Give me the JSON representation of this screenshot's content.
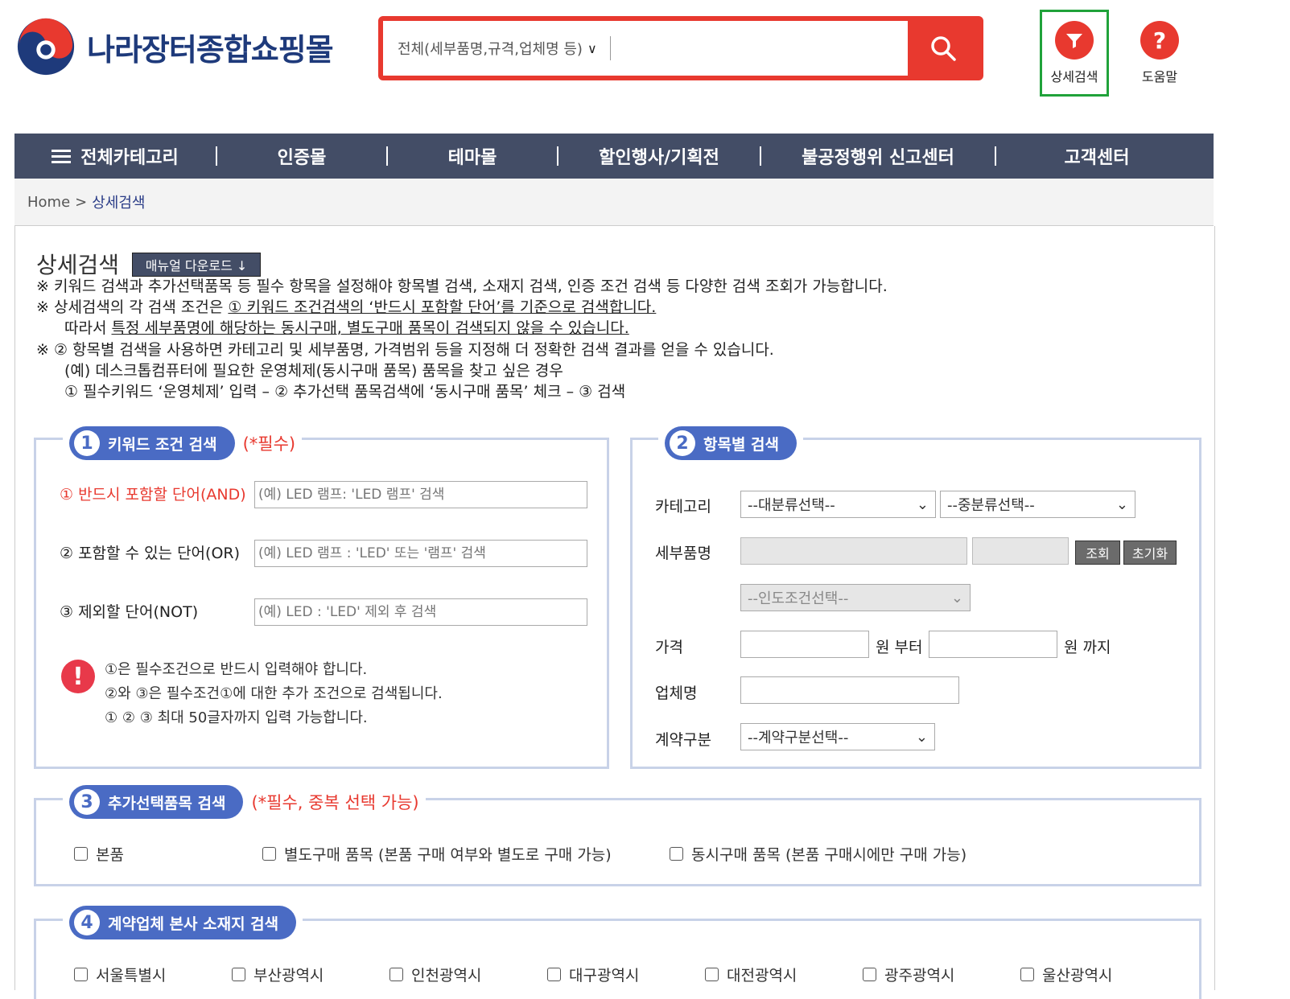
{
  "header": {
    "logo_text": "나라장터종합쇼핑몰",
    "search_scope": "전체(세부품명,규격,업체명 등)",
    "search_value": "",
    "advanced_search_label": "상세검색",
    "help_label": "도움말",
    "colors": {
      "brand_red": "#e8392f",
      "brand_navy": "#1e3a7b",
      "highlight_green": "#20a23a"
    }
  },
  "nav": {
    "items": [
      "전체카테고리",
      "인증몰",
      "테마몰",
      "할인행사/기획전",
      "불공정행위 신고센터",
      "고객센터"
    ]
  },
  "breadcrumb": {
    "home": "Home",
    "separator": ">",
    "current": "상세검색"
  },
  "page": {
    "title": "상세검색",
    "manual_button": "매뉴얼 다운로드 ↓",
    "notes": {
      "n1_mark": "※",
      "n1": "키워드 검색과 추가선택품목 등 필수 항목을 설정해야 항목별 검색, 소재지 검색, 인증 조건 검색 등 다양한 검색 조회가 가능합니다.",
      "n2_mark": "※",
      "n2_a": "상세검색의 각 검색 조건은 ",
      "n2_b": "① 키워드 조건검색의 ‘반드시 포함할 단어’를 기준으로 검색합니다.",
      "n3_a": "따라서 ",
      "n3_b": "특정 세부품명에 해당하는 동시구매, 별도구매 품목이 검색되지 않을 수 있습니다.",
      "n4_mark": "※",
      "n4": "② 항목별 검색을 사용하면 카테고리 및 세부품명, 가격범위 등을 지정해 더 정확한 검색 결과를 얻을 수 있습니다.",
      "n5": "(예) 데스크톱컴퓨터에 필요한 운영체제(동시구매 품목) 품목을 찾고 싶은 경우",
      "n6": "① 필수키워드 ‘운영체제’ 입력 – ② 추가선택 품목검색에 ‘동시구매 품목’ 체크 – ③ 검색"
    }
  },
  "keyword_section": {
    "number": "1",
    "title": "키워드 조건 검색",
    "required_note": "(*필수)",
    "fields": [
      {
        "label": "① 반드시 포함할 단어(AND)",
        "placeholder": "(예) LED 램프: 'LED 램프' 검색"
      },
      {
        "label": "② 포함할 수 있는 단어(OR)",
        "placeholder": "(예) LED 램프 : 'LED' 또는 '램프' 검색"
      },
      {
        "label": "③ 제외할 단어(NOT)",
        "placeholder": "(예) LED : 'LED' 제외 후 검색"
      }
    ],
    "warnings": [
      "①은 필수조건으로 반드시 입력해야 합니다.",
      "②와 ③은 필수조건①에 대한 추가 조건으로 검색됩니다.",
      "① ② ③ 최대 50글자까지 입력 가능합니다."
    ]
  },
  "item_section": {
    "number": "2",
    "title": "항목별 검색",
    "category_label": "카테고리",
    "category_major": "--대분류선택--",
    "category_middle": "--중분류선택--",
    "detail_label": "세부품명",
    "lookup_button": "조회",
    "reset_button": "초기화",
    "delivery_select": "--인도조건선택--",
    "price_label": "가격",
    "price_from_suffix": "원 부터",
    "price_to_suffix": "원 까지",
    "company_label": "업체명",
    "contract_label": "계약구분",
    "contract_select": "--계약구분선택--"
  },
  "extra_section": {
    "number": "3",
    "title": "추가선택품목 검색",
    "required_note": "(*필수, 중복 선택 가능)",
    "options": [
      "본품",
      "별도구매 품목 (본품 구매 여부와 별도로 구매 가능)",
      "동시구매 품목 (본품 구매시에만 구매 가능)"
    ]
  },
  "location_section": {
    "number": "4",
    "title": "계약업체 본사 소재지 검색",
    "options": [
      "서울특별시",
      "부산광역시",
      "인천광역시",
      "대구광역시",
      "대전광역시",
      "광주광역시",
      "울산광역시"
    ]
  }
}
